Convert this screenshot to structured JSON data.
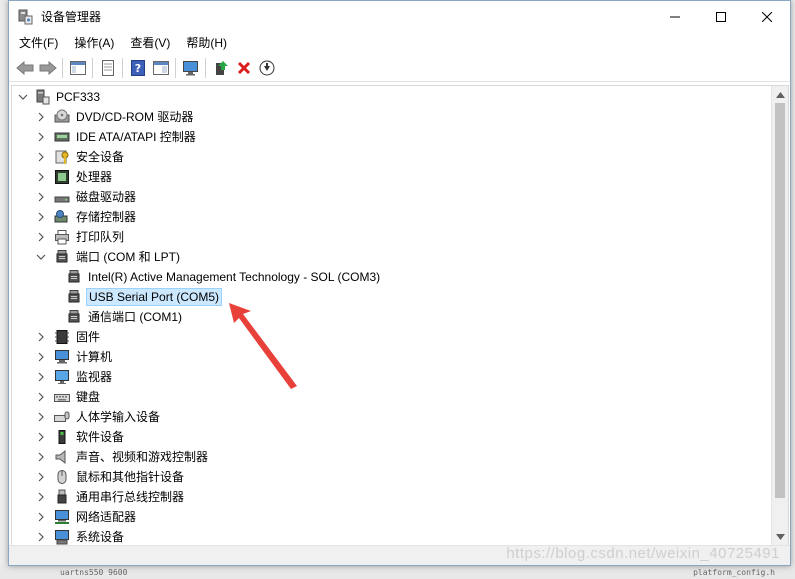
{
  "window": {
    "title": "设备管理器"
  },
  "menu": [
    "文件(F)",
    "操作(A)",
    "查看(V)",
    "帮助(H)"
  ],
  "toolbar": {
    "buttons": [
      "back-icon",
      "forward-icon",
      "properties-pane-icon",
      "sheet-icon",
      "help-icon",
      "view-icon",
      "monitor-icon",
      "update-driver-icon",
      "uninstall-icon",
      "download-icon"
    ]
  },
  "tree": {
    "root": "PCF333",
    "categories": [
      {
        "label": "DVD/CD-ROM 驱动器",
        "icon": "dvd-icon"
      },
      {
        "label": "IDE ATA/ATAPI 控制器",
        "icon": "ide-icon"
      },
      {
        "label": "安全设备",
        "icon": "security-key-icon"
      },
      {
        "label": "处理器",
        "icon": "processor-icon"
      },
      {
        "label": "磁盘驱动器",
        "icon": "disk-icon"
      },
      {
        "label": "存储控制器",
        "icon": "storage-icon"
      },
      {
        "label": "打印队列",
        "icon": "printer-icon"
      },
      {
        "label": "端口 (COM 和 LPT)",
        "icon": "port-icon",
        "expanded": true,
        "children": [
          {
            "label": "Intel(R) Active Management Technology - SOL (COM3)"
          },
          {
            "label": "USB Serial Port (COM5)",
            "selected": true
          },
          {
            "label": "通信端口 (COM1)"
          }
        ]
      },
      {
        "label": "固件",
        "icon": "firmware-icon"
      },
      {
        "label": "计算机",
        "icon": "computer-icon"
      },
      {
        "label": "监视器",
        "icon": "monitor-icon"
      },
      {
        "label": "键盘",
        "icon": "keyboard-icon"
      },
      {
        "label": "人体学输入设备",
        "icon": "hid-icon"
      },
      {
        "label": "软件设备",
        "icon": "software-device-icon"
      },
      {
        "label": "声音、视频和游戏控制器",
        "icon": "audio-icon"
      },
      {
        "label": "鼠标和其他指针设备",
        "icon": "mouse-icon"
      },
      {
        "label": "通用串行总线控制器",
        "icon": "usb-icon"
      },
      {
        "label": "网络适配器",
        "icon": "network-icon"
      },
      {
        "label": "系统设备",
        "icon": "system-device-icon"
      }
    ]
  },
  "watermark": "https://blog.csdn.net/weixin_40725491",
  "backdrop": {
    "bottom_left": "uartns550   9600",
    "bottom_right": "platform_config.h"
  },
  "colors": {
    "selection_bg": "#cce8ff",
    "selection_border": "#99d1ff",
    "annotation_arrow": "#e8413a",
    "uninstall_red": "#d81e1e"
  }
}
